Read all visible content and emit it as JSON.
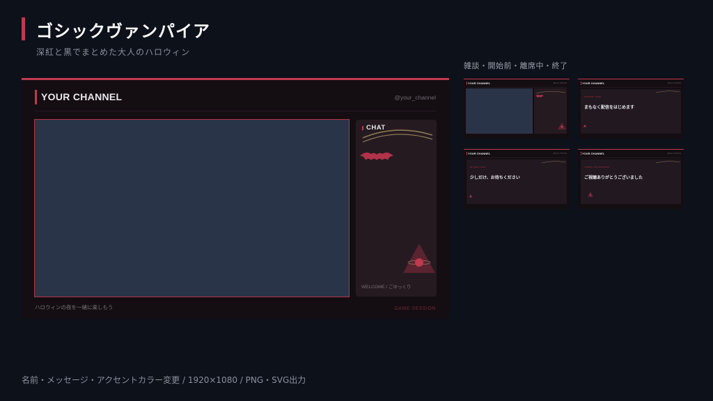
{
  "header": {
    "title": "ゴシックヴァンパイア",
    "subtitle": "深紅と黒でまとめた大人のハロウィン"
  },
  "colors": {
    "accent": "#c0394f",
    "background": "#0d111a",
    "panel": "#140d12",
    "video_placeholder": "#2a3448",
    "chat_panel": "#261a21",
    "gold": "#8a7a55"
  },
  "preview": {
    "channel_name": "YOUR CHANNEL",
    "handle": "@your_channel",
    "chat_label": "CHAT",
    "welcome_text": "WELCOME / ごゆっくり",
    "footer_left": "ハロウィンの夜を一緒に楽しもう",
    "footer_right": "GAME SESSION",
    "icons": [
      "bat-icon",
      "pyramid-eye-icon",
      "gold-arc-icon"
    ]
  },
  "variants": {
    "label": "雑談・開始前・離席中・終了",
    "items": [
      {
        "type": "chat",
        "channel_name": "YOUR CHANNEL",
        "handle": "@your_channel",
        "small": "",
        "message": "",
        "sub": ""
      },
      {
        "type": "start",
        "channel_name": "YOUR CHANNEL",
        "handle": "@your_channel",
        "small": "STARTING SOON",
        "message": "まもなく配信をはじめます",
        "sub": ""
      },
      {
        "type": "away",
        "channel_name": "YOUR CHANNEL",
        "handle": "@your_channel",
        "small": "BE RIGHT BACK",
        "message": "少しだけ、お待ちください",
        "sub": ""
      },
      {
        "type": "end",
        "channel_name": "YOUR CHANNEL",
        "handle": "@your_channel",
        "small": "THANKS FOR WATCHING",
        "message": "ご視聴ありがとうございました",
        "sub": ""
      }
    ]
  },
  "footer_note": "名前・メッセージ・アクセントカラー変更 / 1920×1080 / PNG・SVG出力"
}
